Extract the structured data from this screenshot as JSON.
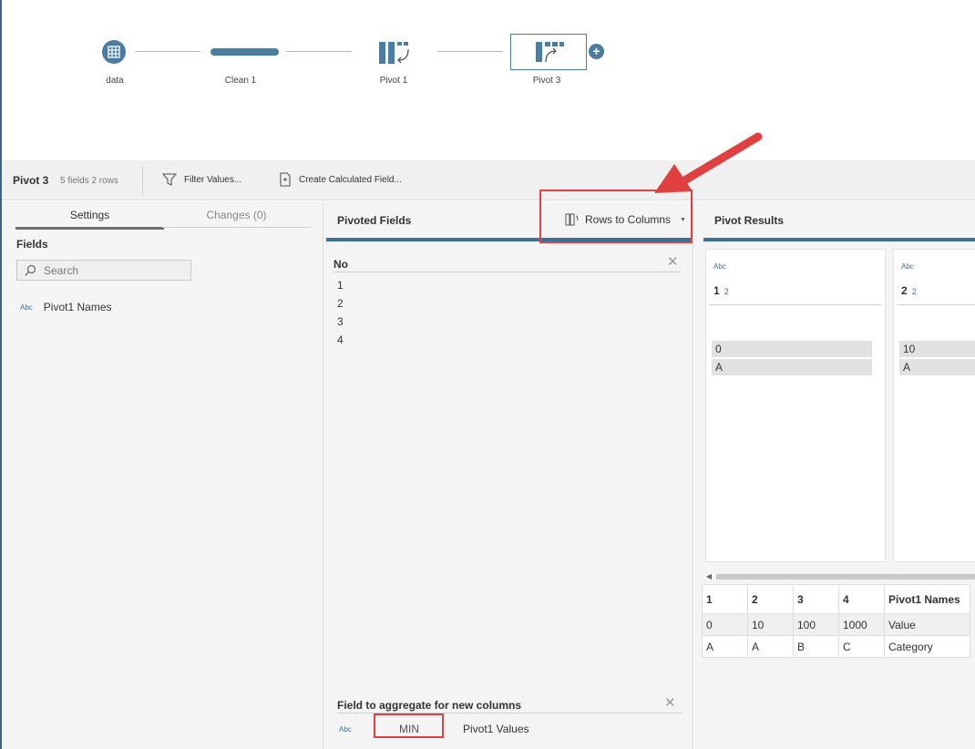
{
  "flow": {
    "nodes": [
      {
        "label": "data",
        "icon": "table-icon"
      },
      {
        "label": "Clean 1",
        "icon": "clean-step-icon"
      },
      {
        "label": "Pivot 1",
        "icon": "pivot-icon"
      },
      {
        "label": "Pivot 3",
        "icon": "pivot-icon"
      }
    ],
    "accent": "#4b7ca1"
  },
  "toolbar": {
    "title": "Pivot 3",
    "meta": "5 fields  2 rows",
    "filter_label": "Filter Values...",
    "calc_label": "Create Calculated Field..."
  },
  "settings": {
    "tab_settings": "Settings",
    "tab_changes": "Changes (0)",
    "fields_heading": "Fields",
    "search_placeholder": "Search",
    "field_type": "Abc",
    "field_name": "Pivot1 Names"
  },
  "pivoted": {
    "title": "Pivoted Fields",
    "mode": "Rows to Columns",
    "column_heading": "No",
    "values": [
      "1",
      "2",
      "3",
      "4"
    ],
    "aggregate_heading": "Field to aggregate for new columns",
    "aggregate_type": "Abc",
    "aggregate_fn": "MIN",
    "aggregate_field": "Pivot1 Values"
  },
  "results": {
    "title": "Pivot Results",
    "cards": [
      {
        "type": "Abc",
        "name": "1",
        "count": "2",
        "values": [
          "0",
          "A"
        ]
      },
      {
        "type": "Abc",
        "name": "2",
        "count": "2",
        "values": [
          "10",
          "A"
        ]
      }
    ],
    "table": {
      "headers": [
        "1",
        "2",
        "3",
        "4",
        "Pivot1 Names"
      ],
      "rows": [
        [
          "0",
          "10",
          "100",
          "1000",
          "Value"
        ],
        [
          "A",
          "A",
          "B",
          "C",
          "Category"
        ]
      ]
    }
  },
  "colors": {
    "highlight": "#e04040",
    "panel_accent": "#3d6f94"
  }
}
